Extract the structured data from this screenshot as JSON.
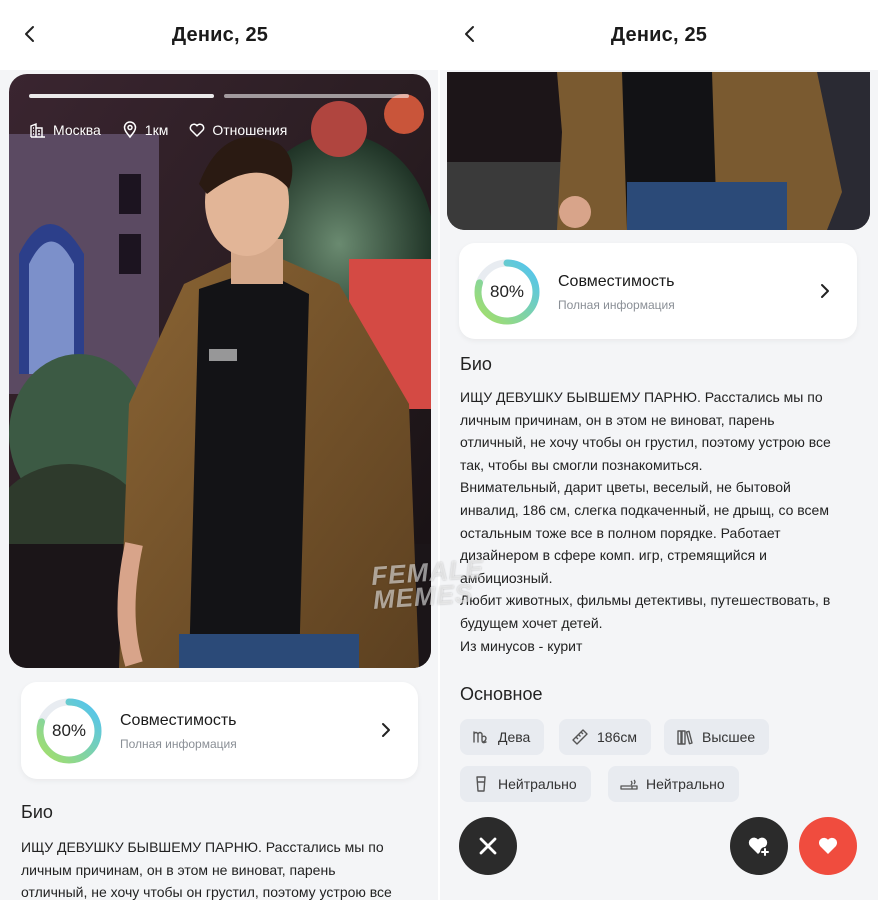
{
  "profile": {
    "title": "Денис, 25",
    "location": "Москва",
    "distance": "1км",
    "goal": "Отношения",
    "photo_progress_segments": 2,
    "photo_active_segment": 1
  },
  "compatibility": {
    "percent_label": "80%",
    "percent_value": 0.8,
    "title": "Совместимость",
    "subtitle": "Полная информация"
  },
  "bio": {
    "heading": "Био",
    "text_left_partial": "ИЩУ ДЕВУШКУ БЫВШЕМУ ПАРНЮ. Расстались мы по\nличным причинам, он в этом не виноват, парень\nотличный, не хочу чтобы он грустил, поэтому устрою все",
    "text_full": "ИЩУ ДЕВУШКУ БЫВШЕМУ ПАРНЮ. Расстались мы по\nличным причинам, он в этом не виноват, парень\nотличный, не хочу чтобы он грустил, поэтому устрою все\nтак, чтобы вы смогли познакомиться.\nВнимательный, дарит цветы, веселый, не бытовой\nинвалид, 186 см, слегка подкаченный, не дрыщ, со всем\nостальным тоже все в полном порядке. Работает\nдизайнером в сфере комп. игр, стремящийся и\nамбициозный.\nЛюбит животных, фильмы детективы, путешествовать, в\nбудущем хочет детей.\n Из минусов - курит"
  },
  "basics": {
    "heading": "Основное",
    "zodiac": "Дева",
    "height": "186см",
    "education": "Высшее",
    "alcohol": "Нейтрально",
    "smoking": "Нейтрально"
  },
  "watermark": {
    "line1": "FEMALE",
    "line2": "MEMES"
  },
  "colors": {
    "like": "#f04c3e",
    "dark_button": "#2b2b2b",
    "ring_start": "#a8e063",
    "ring_end": "#4fc3f7"
  },
  "icons": {
    "back": "chevron-left-icon",
    "city": "city-icon",
    "location": "location-pin-icon",
    "goal": "heart-outline-icon",
    "chevron": "chevron-right-icon",
    "zodiac": "virgo-icon",
    "height": "ruler-icon",
    "education": "books-icon",
    "alcohol": "glass-icon",
    "smoking": "cigarette-icon",
    "dislike": "close-icon",
    "superlike": "heart-plus-icon",
    "like": "heart-icon"
  }
}
